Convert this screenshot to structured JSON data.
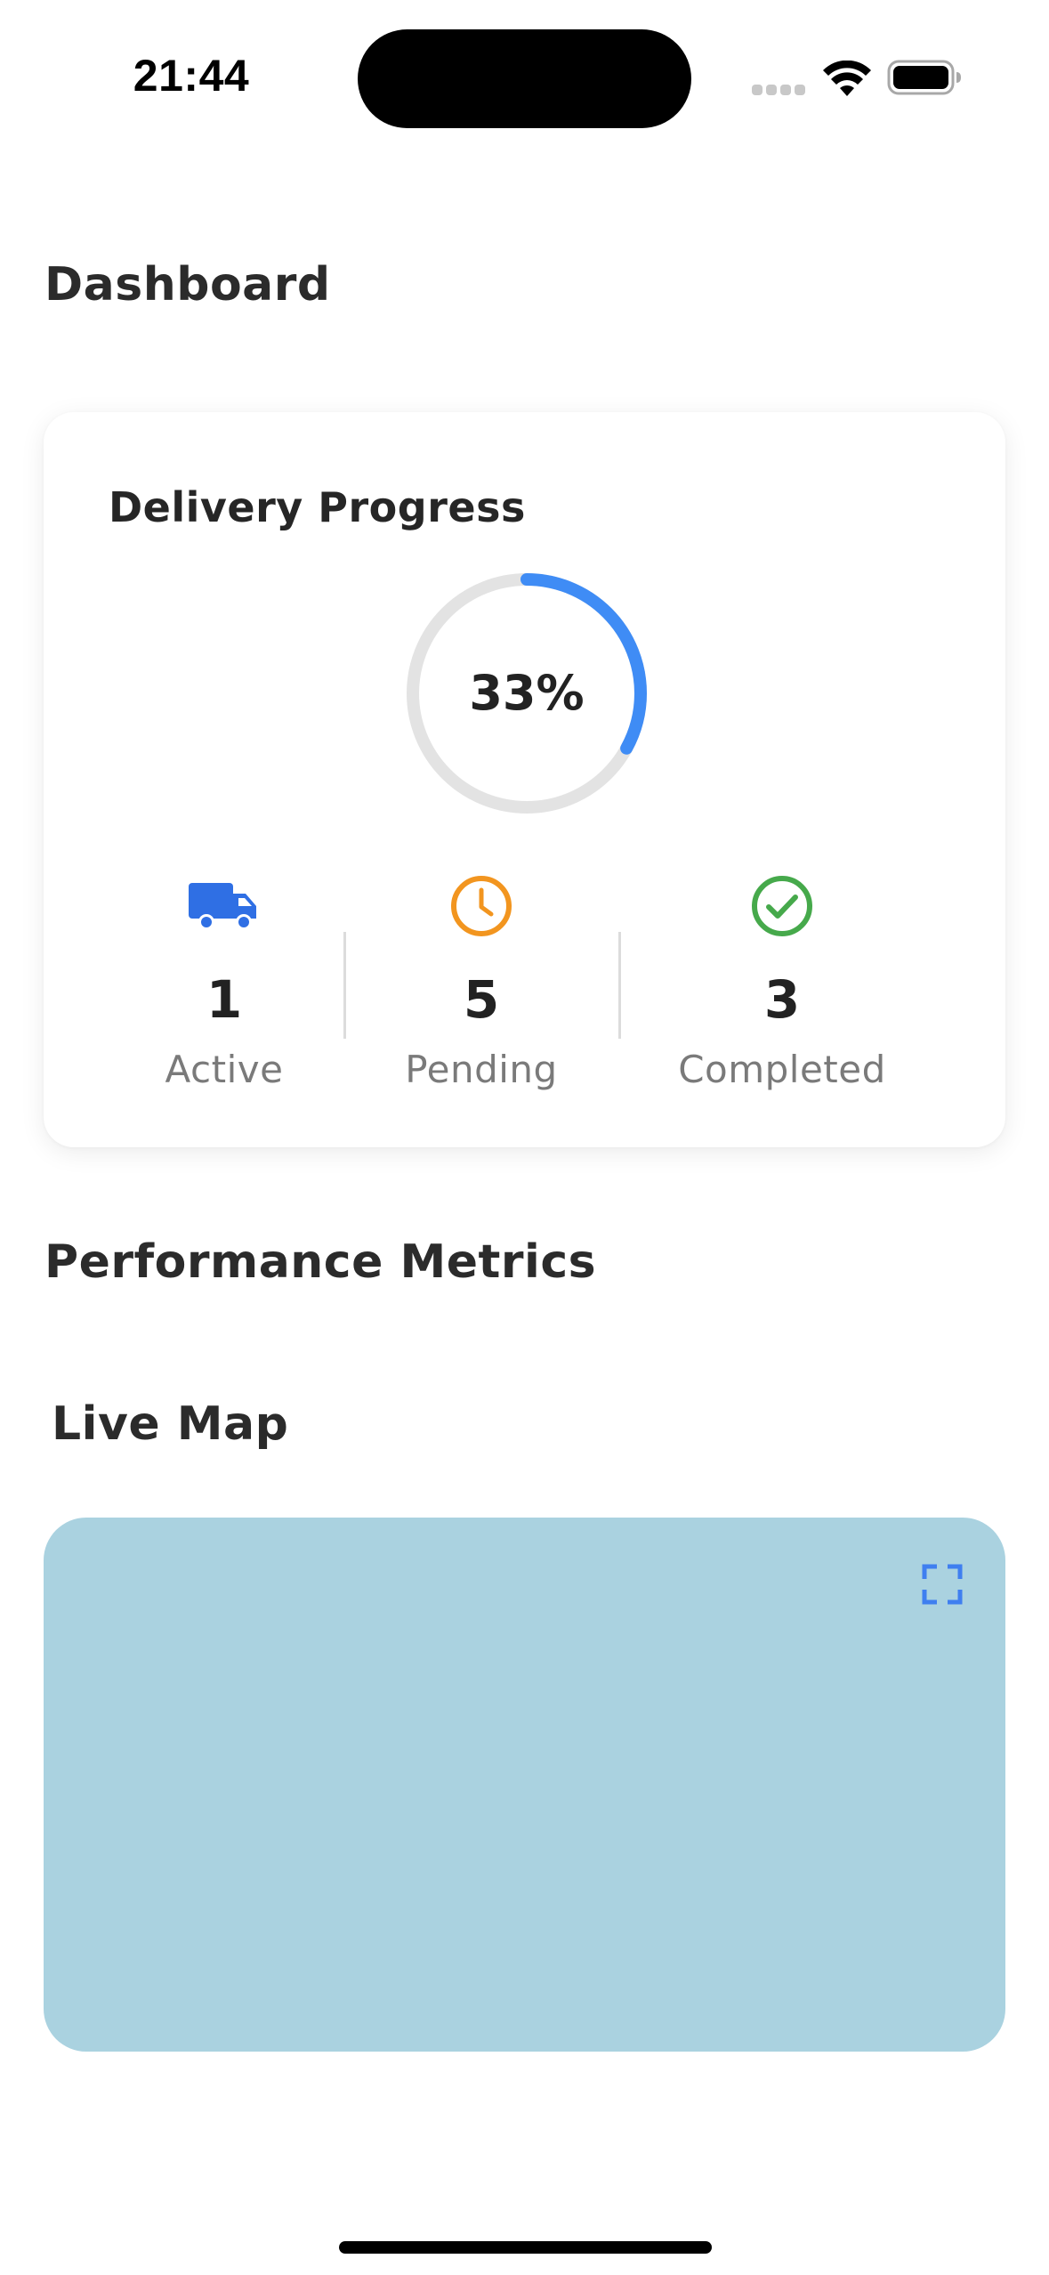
{
  "status_bar": {
    "time": "21:44",
    "icons": [
      "cellular-signal-icon",
      "wifi-icon",
      "battery-icon"
    ]
  },
  "page": {
    "title": "Dashboard"
  },
  "delivery_card": {
    "title": "Delivery Progress",
    "progress_percent_label": "33%",
    "progress_fraction": 0.33,
    "stats": [
      {
        "icon": "truck-icon",
        "value": "1",
        "label": "Active",
        "color": "#2f6fe4"
      },
      {
        "icon": "clock-icon",
        "value": "5",
        "label": "Pending",
        "color": "#f2951f"
      },
      {
        "icon": "check-circle-icon",
        "value": "3",
        "label": "Completed",
        "color": "#46a94b"
      }
    ]
  },
  "sections": {
    "performance_title": "Performance Metrics",
    "map_title": "Live Map"
  },
  "map": {
    "background_color": "#aad2e0",
    "expand_icon": "expand-icon"
  },
  "colors": {
    "accent": "#3f8cf5",
    "ring_track": "#e3e3e3",
    "text_primary": "#222222",
    "text_secondary": "#7a7a7a"
  }
}
